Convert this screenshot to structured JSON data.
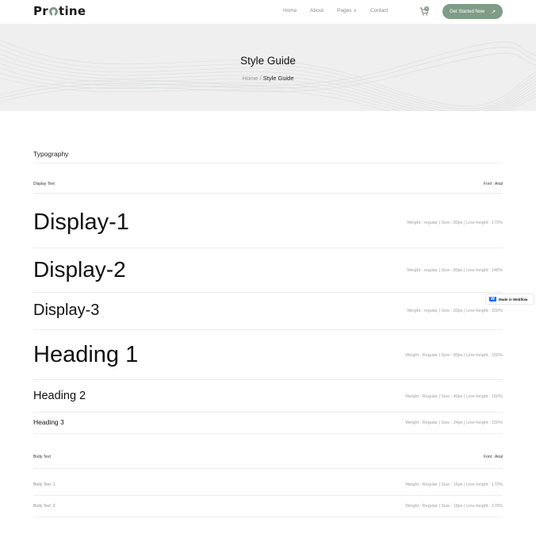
{
  "brand": {
    "logo_prefix": "Pr",
    "logo_suffix": "tine",
    "accent": "#7f9c86"
  },
  "nav": {
    "items": [
      {
        "label": "Home"
      },
      {
        "label": "About"
      },
      {
        "label": "Pages"
      },
      {
        "label": "Contact"
      }
    ],
    "cart_icon": "cart-icon",
    "cart_count": "0",
    "cta_label": "Get Started Now",
    "cta_icon": "arrow-up-right-icon"
  },
  "hero": {
    "title": "Style Guide",
    "breadcrumb_home": "Home",
    "breadcrumb_sep": " / ",
    "breadcrumb_current": "Style Guide",
    "background": "#efefef"
  },
  "typography": {
    "section_title": "Typography",
    "display_label": "Display Text",
    "display_font": "Font : Arial",
    "rows": [
      {
        "sample": "Display-1",
        "spec": "Weight : regular |  Size : 80px  |  Line-height : 170%"
      },
      {
        "sample": "Display-2",
        "spec": "Weight : regular |  Size : 80px  |  Line-height : 140%"
      },
      {
        "sample": "Display-3",
        "spec": "Weight : regular |  Size : 60px  |  Line-height : 150%"
      },
      {
        "sample": "Heading 1",
        "spec": "Weight : Regular  |  Size : 80px  |  Line-height : 150%"
      },
      {
        "sample": "Heading 2",
        "spec": "Weight : Regular  |  Size : 40px  |  Line-height : 150%"
      },
      {
        "sample": "Heading 3",
        "spec": "Weight : Regular  |  Size : 24px  |  Line-height : 150%"
      }
    ],
    "body_label": "Body Text",
    "body_font": "Font : Arial",
    "body_rows": [
      {
        "sample": "Body Text -1",
        "spec": "Weight : Regular |  Size : 16px  |  Line-height : 170%"
      },
      {
        "sample": "Body Text -2",
        "spec": "Weight : Regular |  Size : 18px  |  Line-height : 170%"
      }
    ]
  },
  "badge": {
    "label": "Made in Webflow",
    "icon": "webflow-icon"
  }
}
